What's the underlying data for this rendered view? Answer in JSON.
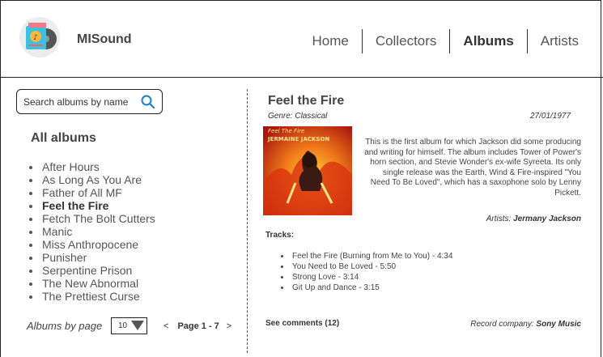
{
  "header": {
    "brand": "MISound",
    "nav": [
      {
        "label": "Home"
      },
      {
        "label": "Collectors"
      },
      {
        "label": "Albums"
      },
      {
        "label": "Artists"
      }
    ]
  },
  "sidebar": {
    "search_placeholder": "Search albums by name",
    "title": "All albums",
    "albums": [
      "After Hours",
      "As Long As You Are",
      "Father of All MF",
      "Feel the Fire",
      "Fetch The Bolt Cutters",
      "Manic",
      "Miss Anthropocene",
      "Punisher",
      "Serpentine Prison",
      "The New Abnormal",
      "The Prettiest Curse"
    ],
    "selected_album": "Feel the Fire",
    "pager": {
      "label": "Albums by page",
      "page_size": "10",
      "prev": "<",
      "pages": "Page 1 - 7",
      "next": ">"
    }
  },
  "detail": {
    "title": "Feel the Fire",
    "genre": "Genre: Classical",
    "date": "27/01/1977",
    "cover_text_top": "Feel The Fire",
    "cover_text_bottom": "JERMAINE JACKSON",
    "description": "This is the first album for which Jackson did some producing and writing for himself. The album includes Tower of Power's horn section, and Stevie Wonder's ex-wife Syreeta. Its only single release was the Earth, Wind & Fire-inspired \"You Need To Be Loved\", which has a saxophone solo by Lenny Pickett.",
    "artists_label": "Artists:",
    "artists_value": "Jermany Jackson",
    "tracks_title": "Tracks:",
    "tracks": [
      "Feel the Fire (Burning from Me to You) - 4:34",
      "You Need to Be Loved - 5:50",
      "Strong Love - 3:14",
      "Git Up and Dance - 3:15"
    ],
    "comments_label": "See comments (12)",
    "record_label": "Record company:",
    "record_value": "Sony Music"
  },
  "colors": {
    "accent": "#1e7fd1",
    "border": "#222222",
    "text": "#444444"
  }
}
